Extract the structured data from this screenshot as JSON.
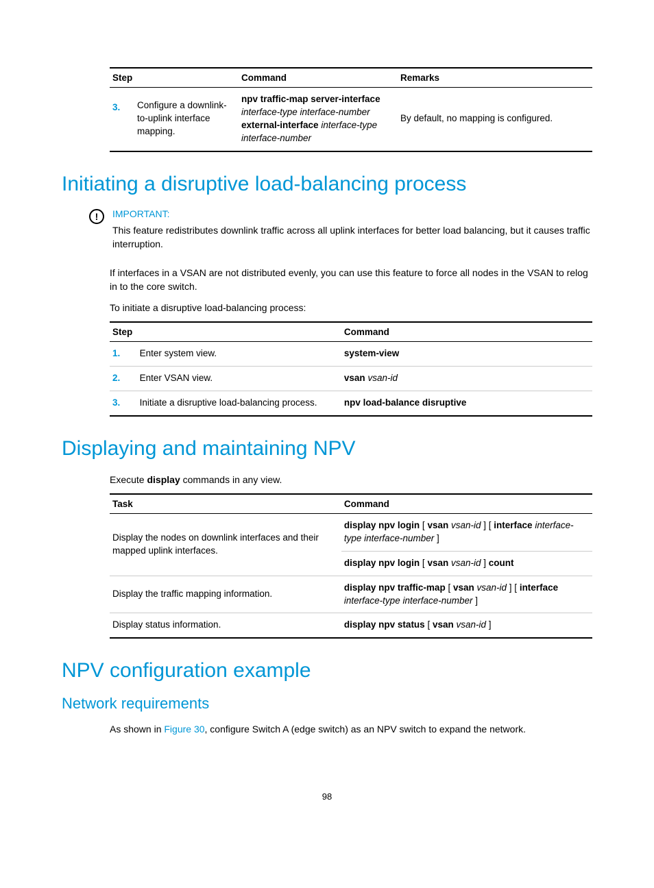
{
  "table1": {
    "headers": {
      "step": "Step",
      "command": "Command",
      "remarks": "Remarks"
    },
    "row": {
      "num": "3.",
      "stepText": "Configure a downlink-to-uplink interface mapping.",
      "cmd_b1": "npv traffic-map server-interface",
      "cmd_i1": "interface-type interface-number",
      "cmd_b2": "external-interface",
      "cmd_i2": "interface-type interface-number",
      "remarks": "By default, no mapping is configured."
    }
  },
  "section1": {
    "heading": "Initiating a disruptive load-balancing process",
    "importantLabel": "IMPORTANT:",
    "importantText": "This feature redistributes downlink traffic across all uplink interfaces for better load balancing, but it causes traffic interruption.",
    "p1": "If interfaces in a VSAN are not distributed evenly, you can use this feature to force all nodes in the VSAN to relog in to the core switch.",
    "p2": "To initiate a disruptive load-balancing process:",
    "table": {
      "headers": {
        "step": "Step",
        "command": "Command"
      },
      "rows": [
        {
          "num": "1.",
          "step": "Enter system view.",
          "cmd_b": "system-view",
          "cmd_i": ""
        },
        {
          "num": "2.",
          "step": "Enter VSAN view.",
          "cmd_b": "vsan",
          "cmd_i": "vsan-id"
        },
        {
          "num": "3.",
          "step": "Initiate a disruptive load-balancing process.",
          "cmd_b": "npv load-balance disruptive",
          "cmd_i": ""
        }
      ]
    }
  },
  "section2": {
    "heading": "Displaying and maintaining NPV",
    "p_pre": "Execute ",
    "p_bold": "display",
    "p_post": " commands in any view.",
    "table": {
      "headers": {
        "task": "Task",
        "command": "Command"
      },
      "row1": {
        "task": "Display the nodes on downlink interfaces and their mapped uplink interfaces.",
        "cmd1_b1": "display npv login",
        "cmd1_t1": " [ ",
        "cmd1_b2": "vsan",
        "cmd1_i1": "vsan-id",
        "cmd1_t2": " ] [ ",
        "cmd1_b3": "interface",
        "cmd1_i2": "interface-type interface-number",
        "cmd1_t3": " ]",
        "cmd2_b1": "display npv login",
        "cmd2_t1": " [ ",
        "cmd2_b2": "vsan",
        "cmd2_i1": "vsan-id",
        "cmd2_t2": " ] ",
        "cmd2_b3": "count"
      },
      "row2": {
        "task": "Display the traffic mapping information.",
        "cmd_b1": "display npv traffic-map",
        "cmd_t1": " [ ",
        "cmd_b2": "vsan",
        "cmd_i1": "vsan-id",
        "cmd_t2": " ] [ ",
        "cmd_b3": "interface",
        "cmd_i2": "interface-type interface-number",
        "cmd_t3": " ]"
      },
      "row3": {
        "task": "Display status information.",
        "cmd_b1": "display npv status",
        "cmd_t1": " [ ",
        "cmd_b2": "vsan",
        "cmd_i1": "vsan-id",
        "cmd_t2": " ]"
      }
    }
  },
  "section3": {
    "heading": "NPV configuration example",
    "sub": "Network requirements",
    "p_pre": "As shown in ",
    "link": "Figure 30",
    "p_post": ", configure Switch A (edge switch) as an NPV switch to expand the network."
  },
  "pageNumber": "98"
}
